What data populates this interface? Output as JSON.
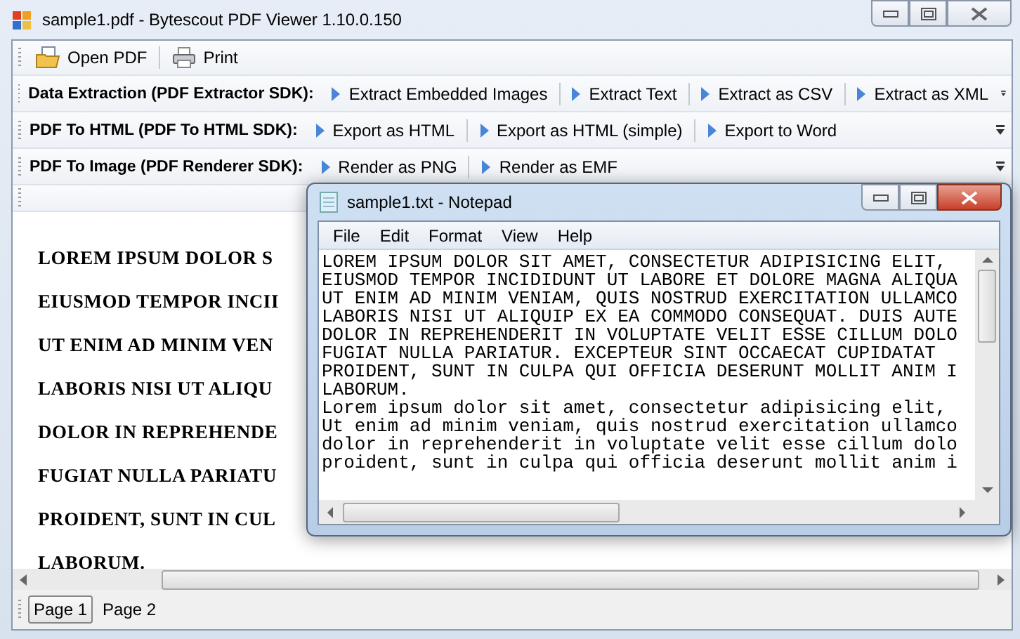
{
  "window": {
    "title": "sample1.pdf - Bytescout PDF Viewer 1.10.0.150"
  },
  "main_toolbar": [
    {
      "label": "Open PDF"
    },
    {
      "label": "Print"
    }
  ],
  "sdk_rows": [
    {
      "heading": "Data Extraction (PDF Extractor SDK):",
      "actions": [
        {
          "label": "Extract Embedded Images"
        },
        {
          "label": "Extract Text"
        },
        {
          "label": "Extract as CSV"
        },
        {
          "label": "Extract as XML"
        }
      ]
    },
    {
      "heading": "PDF To HTML (PDF To HTML SDK):",
      "actions": [
        {
          "label": "Export as HTML"
        },
        {
          "label": "Export as HTML (simple)"
        },
        {
          "label": "Export to Word"
        }
      ]
    },
    {
      "heading": "PDF To Image (PDF Renderer SDK):",
      "actions": [
        {
          "label": "Render as PNG"
        },
        {
          "label": "Render as EMF"
        }
      ]
    }
  ],
  "document": {
    "lines": [
      "LOREM IPSUM DOLOR S",
      "EIUSMOD TEMPOR INCII",
      "UT ENIM AD MINIM VEN",
      "LABORIS NISI UT ALIQU",
      "DOLOR IN REPREHENDE",
      "FUGIAT NULLA PARIATU",
      "PROIDENT, SUNT IN CUL",
      "LABORUM."
    ]
  },
  "page_tabs": [
    {
      "label": "Page 1",
      "selected": true
    },
    {
      "label": "Page 2",
      "selected": false
    }
  ],
  "notepad": {
    "title": "sample1.txt - Notepad",
    "menu": [
      "File",
      "Edit",
      "Format",
      "View",
      "Help"
    ],
    "lines": [
      "LOREM IPSUM DOLOR SIT AMET, CONSECTETUR ADIPISICING ELIT,",
      "EIUSMOD TEMPOR INCIDIDUNT UT LABORE ET DOLORE MAGNA ALIQUA",
      "UT ENIM AD MINIM VENIAM, QUIS NOSTRUD EXERCITATION ULLAMCO",
      "LABORIS NISI UT ALIQUIP EX EA COMMODO CONSEQUAT. DUIS AUTE",
      "DOLOR IN REPREHENDERIT IN VOLUPTATE VELIT ESSE CILLUM DOLO",
      "FUGIAT NULLA PARIATUR. EXCEPTEUR SINT OCCAECAT CUPIDATAT",
      "PROIDENT, SUNT IN CULPA QUI OFFICIA DESERUNT MOLLIT ANIM I",
      "LABORUM.",
      "Lorem ipsum dolor sit amet, consectetur adipisicing elit,",
      "Ut enim ad minim veniam, quis nostrud exercitation ullamco",
      "dolor in reprehenderit in voluptate velit esse cillum dolo",
      "proident, sunt in culpa qui officia deserunt mollit anim i"
    ]
  }
}
